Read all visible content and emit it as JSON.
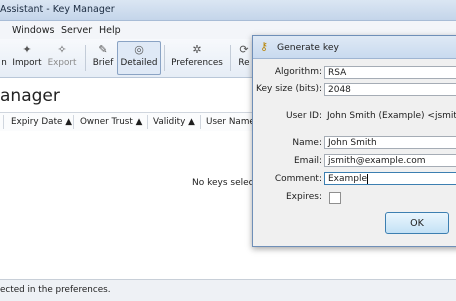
{
  "window": {
    "title": "Assistant - Key Manager"
  },
  "menu": {
    "items": [
      "Windows",
      "Server",
      "Help"
    ]
  },
  "toolbar": {
    "import_label": "Import",
    "export_label": "Export",
    "brief_label": "Brief",
    "detailed_label": "Detailed",
    "preferences_label": "Preferences",
    "refresh_label": "Re"
  },
  "main": {
    "heading": "anager",
    "columns": [
      "Expiry Date ▲",
      "Owner Trust ▲",
      "Validity ▲",
      "User Name"
    ],
    "empty_text": "No keys select"
  },
  "status": {
    "text": "ected in the preferences."
  },
  "dialog": {
    "title": "Generate key",
    "algorithm_label": "Algorithm:",
    "algorithm_value": "RSA",
    "keysize_label": "Key size (bits):",
    "keysize_value": "2048",
    "userid_label": "User ID:",
    "userid_value": "John Smith (Example) <jsmith@",
    "name_label": "Name:",
    "name_value": "John Smith",
    "email_label": "Email:",
    "email_value": "jsmith@example.com",
    "comment_label": "Comment:",
    "comment_value": "Example",
    "expires_label": "Expires:",
    "expires_checked": false,
    "ok_label": "OK"
  }
}
